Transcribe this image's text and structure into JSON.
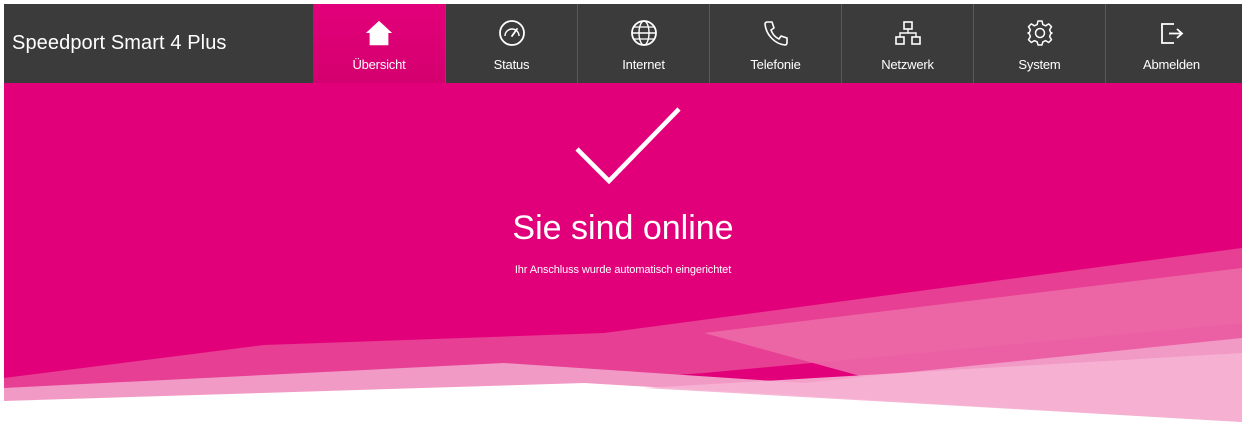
{
  "header": {
    "brand": "Speedport Smart 4 Plus"
  },
  "nav": {
    "items": [
      {
        "label": "Übersicht",
        "icon": "home-icon",
        "active": true
      },
      {
        "label": "Status",
        "icon": "speedometer-icon",
        "active": false
      },
      {
        "label": "Internet",
        "icon": "globe-icon",
        "active": false
      },
      {
        "label": "Telefonie",
        "icon": "phone-icon",
        "active": false
      },
      {
        "label": "Netzwerk",
        "icon": "network-icon",
        "active": false
      },
      {
        "label": "System",
        "icon": "gear-icon",
        "active": false
      },
      {
        "label": "Abmelden",
        "icon": "logout-icon",
        "active": false
      }
    ]
  },
  "hero": {
    "icon": "checkmark-icon",
    "headline": "Sie sind online",
    "subline": "Ihr Anschluss wurde automatisch eingerichtet"
  },
  "colors": {
    "topbar": "#3b3b3b",
    "magenta": "#e2007a",
    "text": "#ffffff"
  }
}
